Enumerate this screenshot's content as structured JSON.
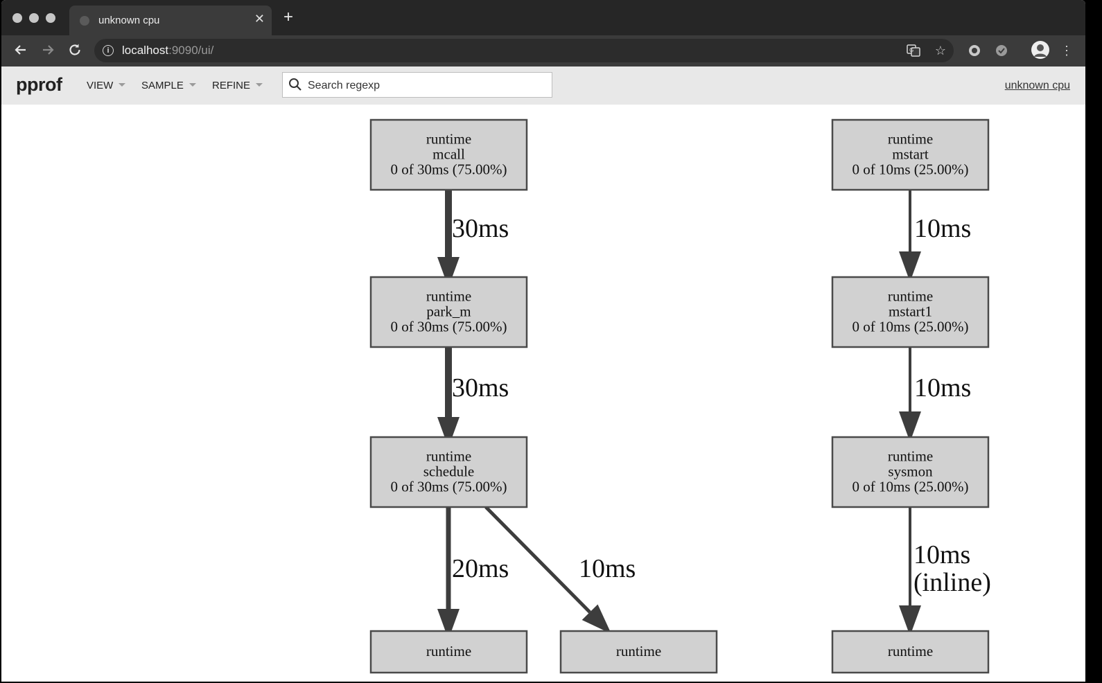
{
  "browser": {
    "tab_title": "unknown cpu",
    "new_tab_icon": "plus-icon",
    "close_tab_icon": "close-icon",
    "url_host": "localhost",
    "url_rest": ":9090/ui/",
    "icons": [
      "back-icon",
      "forward-icon",
      "reload-icon",
      "info-icon",
      "translate-icon",
      "star-icon",
      "extension-icon",
      "extension-check-icon",
      "avatar",
      "more-menu-icon"
    ]
  },
  "header": {
    "logo": "pprof",
    "menus": [
      {
        "label": "VIEW"
      },
      {
        "label": "SAMPLE"
      },
      {
        "label": "REFINE"
      }
    ],
    "search_placeholder": "Search regexp",
    "profile_label": "unknown cpu"
  },
  "graph": {
    "nodes": [
      {
        "id": "mcall",
        "lines": [
          "runtime",
          "mcall",
          "0 of 30ms (75.00%)"
        ]
      },
      {
        "id": "park_m",
        "lines": [
          "runtime",
          "park_m",
          "0 of 30ms (75.00%)"
        ]
      },
      {
        "id": "schedule",
        "lines": [
          "runtime",
          "schedule",
          "0 of 30ms (75.00%)"
        ]
      },
      {
        "id": "bottom-left",
        "lines": [
          "runtime"
        ]
      },
      {
        "id": "bottom-mid",
        "lines": [
          "runtime"
        ]
      },
      {
        "id": "mstart",
        "lines": [
          "runtime",
          "mstart",
          "0 of 10ms (25.00%)"
        ]
      },
      {
        "id": "mstart1",
        "lines": [
          "runtime",
          "mstart1",
          "0 of 10ms (25.00%)"
        ]
      },
      {
        "id": "sysmon",
        "lines": [
          "runtime",
          "sysmon",
          "0 of 10ms (25.00%)"
        ]
      },
      {
        "id": "bottom-right",
        "lines": [
          "runtime"
        ]
      }
    ],
    "edges": [
      {
        "from": "mcall",
        "to": "park_m",
        "label": [
          "30ms"
        ]
      },
      {
        "from": "park_m",
        "to": "schedule",
        "label": [
          "30ms"
        ]
      },
      {
        "from": "schedule",
        "to": "bottom-left",
        "label": [
          "20ms"
        ]
      },
      {
        "from": "schedule",
        "to": "bottom-mid",
        "label": [
          "10ms"
        ]
      },
      {
        "from": "mstart",
        "to": "mstart1",
        "label": [
          "10ms"
        ]
      },
      {
        "from": "mstart1",
        "to": "sysmon",
        "label": [
          "10ms"
        ]
      },
      {
        "from": "sysmon",
        "to": "bottom-right",
        "label": [
          "10ms",
          "(inline)"
        ]
      }
    ]
  }
}
